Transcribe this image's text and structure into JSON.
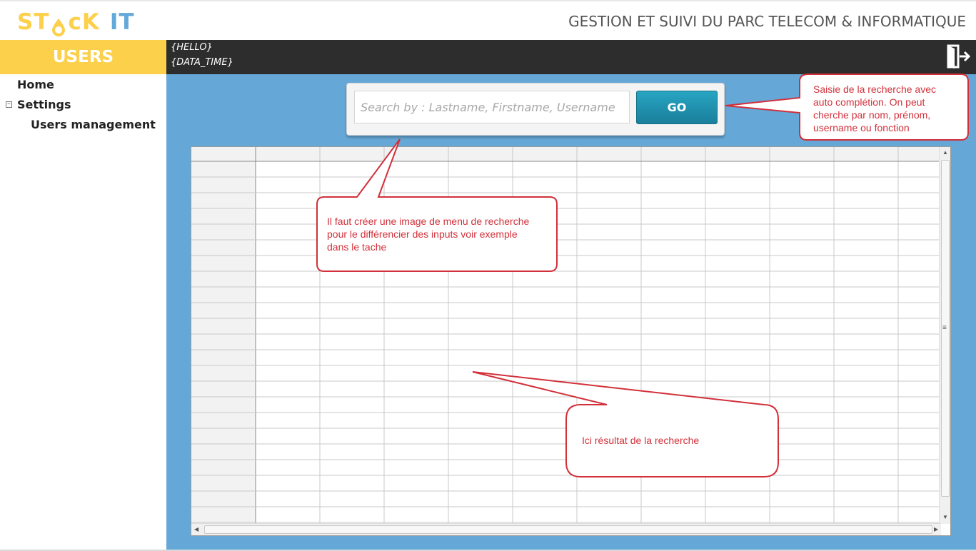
{
  "header": {
    "logo_part1": "ST",
    "logo_part2": "cK",
    "logo_part3": "IT",
    "app_title": "GESTION ET SUIVI DU PARC TELECOM & INFORMATIQUE",
    "section_label": "USERS"
  },
  "topbar": {
    "hello": "{HELLO}",
    "datetime": "{DATA_TIME}",
    "logout_icon": "logout-door-arrow-icon"
  },
  "sidebar": {
    "items": [
      {
        "label": "Home"
      },
      {
        "label": "Settings",
        "expanded": true
      },
      {
        "label": "Users management"
      }
    ],
    "toggle_symbol": "−"
  },
  "search": {
    "placeholder": "Search by : Lastname, Firstname, Username",
    "value": "",
    "go_label": "GO"
  },
  "grid": {
    "columns": 12,
    "rows": 23,
    "cells_empty": true,
    "scroll_middle_glyph": "≡"
  },
  "callouts": {
    "search_note": "Saisie de la recherche avec auto complétion. On peut cherche par nom, prénom, username ou fonction",
    "menu_note": "Il faut créer une image de menu de recherche pour le différencier des inputs voir exemple dans le tache",
    "result_note": "Ici résultat de la recherche"
  },
  "colors": {
    "accent_yellow": "#fcd04a",
    "logo_blue": "#62a8d9",
    "main_blue": "#65a8d8",
    "topbar_dark": "#2d2d2d",
    "go_button": "#1f8fae",
    "callout_red": "#d2303a"
  }
}
